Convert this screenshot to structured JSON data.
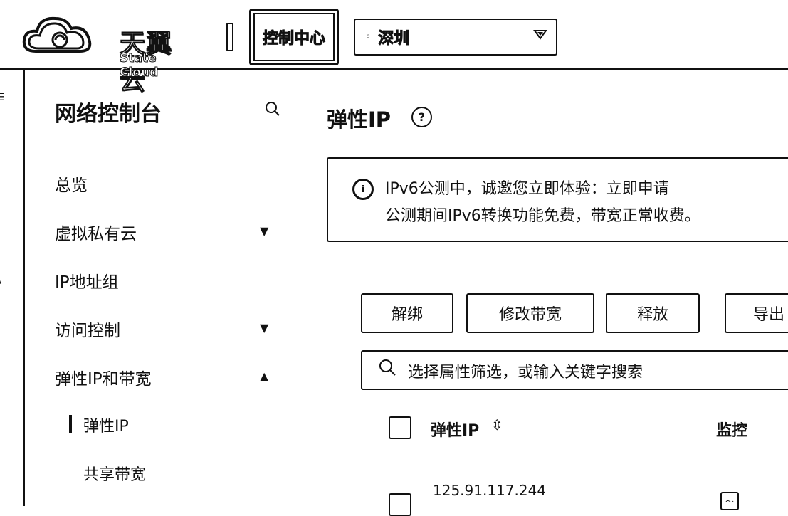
{
  "header": {
    "logo_text": "天翼云",
    "logo_subtext": "State Cloud",
    "control_center_label": "控制中心",
    "region": {
      "pin_icon": "location-pin-icon",
      "value": "深圳",
      "caret_icon": "caret-down-icon"
    }
  },
  "sidebar": {
    "title": "网络控制台",
    "search_icon": "search-icon",
    "items": [
      {
        "label": "总览",
        "arrow": ""
      },
      {
        "label": "虚拟私有云",
        "arrow": "▼"
      },
      {
        "label": "IP地址组",
        "arrow": ""
      },
      {
        "label": "访问控制",
        "arrow": "▼"
      },
      {
        "label": "弹性IP和带宽",
        "arrow": "▲"
      }
    ],
    "sub_items": [
      {
        "label": "弹性IP",
        "active": true
      },
      {
        "label": "共享带宽",
        "active": false
      }
    ]
  },
  "main": {
    "title": "弹性IP",
    "help_icon": "?",
    "notice": {
      "icon": "i",
      "line1": "IPv6公测中，诚邀您立即体验：立即申请",
      "line2": "公测期间IPv6转换功能免费，带宽正常收费。"
    },
    "toolbar": {
      "unbind": "解绑",
      "modify_bandwidth": "修改带宽",
      "release": "释放",
      "export": "导出"
    },
    "search_placeholder": "选择属性筛选，或输入关键字搜索",
    "table": {
      "columns": [
        "弹性IP",
        "监控"
      ],
      "sort_icon": "⇳",
      "rows": [
        {
          "ip": "125.91.117.244"
        }
      ]
    }
  }
}
